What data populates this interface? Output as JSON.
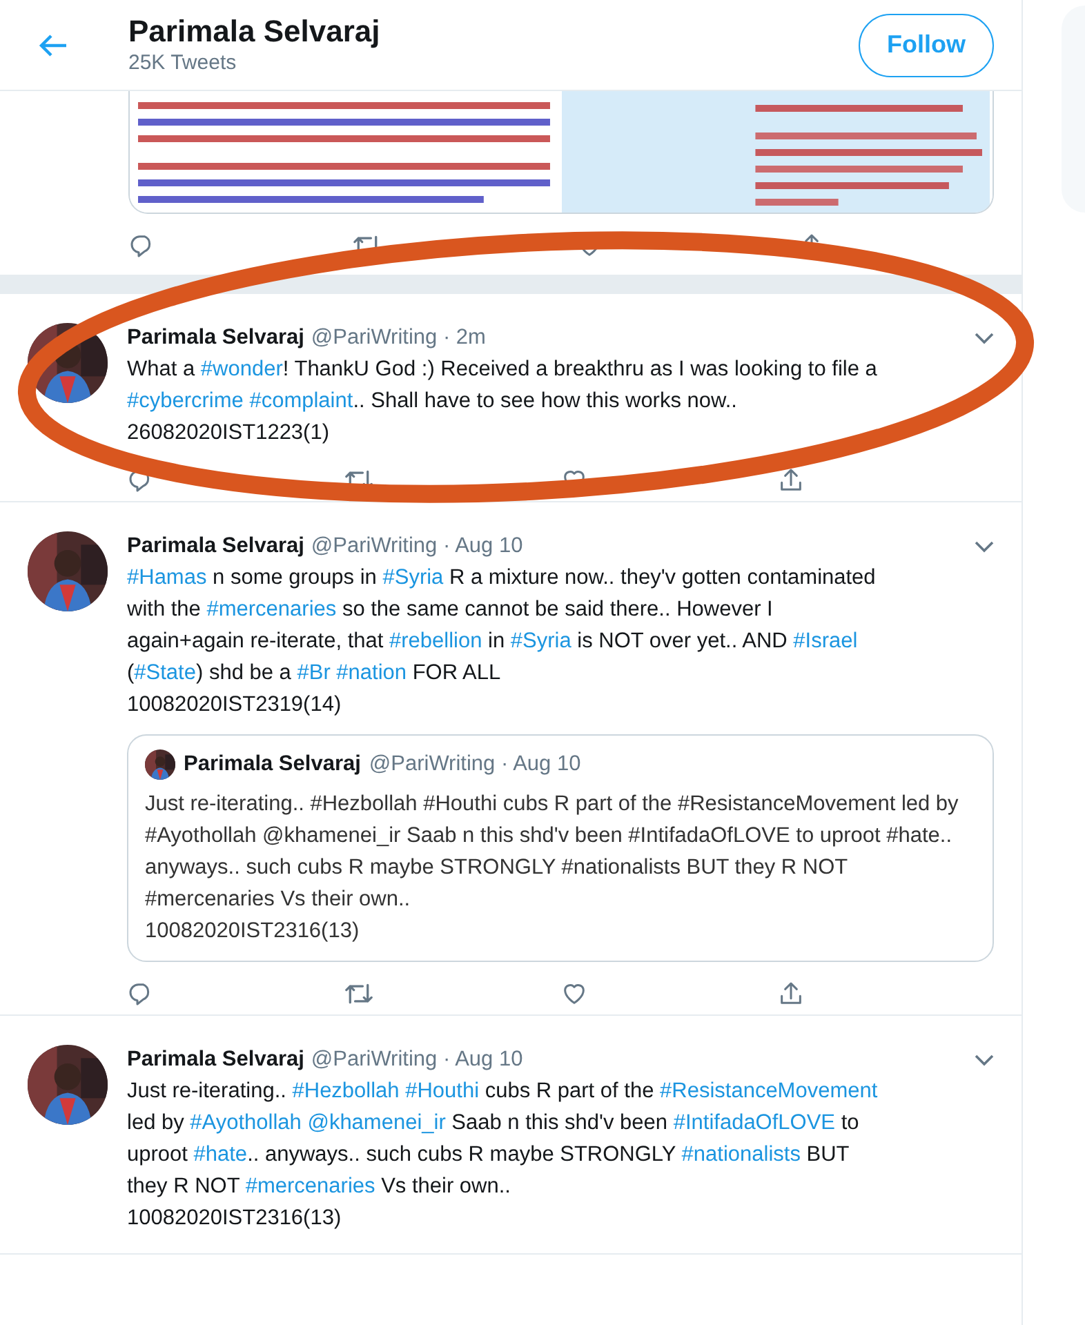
{
  "header": {
    "name": "Parimala Selvaraj",
    "tweet_count": "25K Tweets",
    "follow_label": "Follow"
  },
  "tweets": [
    {
      "kind": "media",
      "actions": true,
      "highlighted": false
    },
    {
      "kind": "text",
      "author": "Parimala Selvaraj",
      "meta": "@PariWriting · 2m",
      "highlighted": true,
      "actions": true,
      "signature": "26082020IST1223(1)",
      "segments": [
        {
          "text": "What a "
        },
        {
          "text": "#wonder",
          "link": true
        },
        {
          "text": "! ThankU God :) Received a breakthru as I was looking to file a "
        },
        {
          "text": "#cybercrime ",
          "link": true
        },
        {
          "text": "#complaint",
          "link": true
        },
        {
          "text": ".. Shall have to see how this works now.."
        }
      ]
    },
    {
      "kind": "text",
      "author": "Parimala Selvaraj",
      "meta": "@PariWriting · Aug 10",
      "highlighted": false,
      "actions": true,
      "signature": "10082020IST2319(14)",
      "segments": [
        {
          "text": "#Hamas",
          "link": true
        },
        {
          "text": " n some groups in "
        },
        {
          "text": "#Syria",
          "link": true
        },
        {
          "text": " R a mixture now.. they'v gotten contaminated with the "
        },
        {
          "text": "#mercenaries",
          "link": true
        },
        {
          "text": " so the same cannot be said there.. However I again+again re-iterate, that "
        },
        {
          "text": "#rebellion",
          "link": true
        },
        {
          "text": " in "
        },
        {
          "text": "#Syria",
          "link": true
        },
        {
          "text": " is NOT over yet.. AND "
        },
        {
          "text": "#Israel",
          "link": true
        },
        {
          "text": " ("
        },
        {
          "text": "#State",
          "link": true
        },
        {
          "text": ") shd be a "
        },
        {
          "text": "#Br ",
          "link": true
        },
        {
          "text": "#nation",
          "link": true
        },
        {
          "text": " FOR ALL"
        }
      ],
      "quote": {
        "author": "Parimala Selvaraj",
        "meta": "@PariWriting · Aug 10",
        "text": "Just re-iterating.. #Hezbollah #Houthi cubs R part of the #ResistanceMovement led by #Ayothollah @khamenei_ir Saab n this shd'v been #IntifadaOfLOVE to uproot #hate.. anyways.. such cubs R maybe STRONGLY #nationalists BUT they R NOT #mercenaries Vs their own..",
        "signature": "10082020IST2316(13)"
      }
    },
    {
      "kind": "text",
      "author": "Parimala Selvaraj",
      "meta": "@PariWriting · Aug 10",
      "highlighted": false,
      "actions": false,
      "signature": "10082020IST2316(13)",
      "segments": [
        {
          "text": "Just re-iterating.. "
        },
        {
          "text": "#Hezbollah ",
          "link": true
        },
        {
          "text": "#Houthi",
          "link": true
        },
        {
          "text": " cubs R part of the "
        },
        {
          "text": "#ResistanceMovement",
          "link": true
        },
        {
          "text": " led by "
        },
        {
          "text": "#Ayothollah ",
          "link": true
        },
        {
          "text": "@khamenei_ir",
          "link": true
        },
        {
          "text": " Saab n this shd'v been "
        },
        {
          "text": "#IntifadaOfLOVE",
          "link": true
        },
        {
          "text": " to uproot "
        },
        {
          "text": "#hate",
          "link": true
        },
        {
          "text": ".. anyways.. such cubs R maybe STRONGLY "
        },
        {
          "text": "#nationalists",
          "link": true
        },
        {
          "text": " BUT they R NOT "
        },
        {
          "text": "#mercenaries",
          "link": true
        },
        {
          "text": " Vs their own.."
        }
      ]
    }
  ]
}
